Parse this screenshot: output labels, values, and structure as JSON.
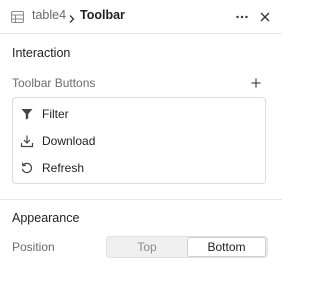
{
  "header": {
    "parent": "table4",
    "current": "Toolbar",
    "icons": {
      "table": "table-icon",
      "separator": "chevron-right-icon",
      "more": "more-horizontal-icon",
      "close": "close-icon"
    }
  },
  "interaction": {
    "title": "Interaction",
    "toolbar_buttons_label": "Toolbar Buttons",
    "add_icon": "plus-icon",
    "buttons": [
      {
        "label": "Filter",
        "icon": "filter-icon"
      },
      {
        "label": "Download",
        "icon": "download-icon"
      },
      {
        "label": "Refresh",
        "icon": "refresh-icon"
      }
    ]
  },
  "appearance": {
    "title": "Appearance",
    "position_label": "Position",
    "position_options": [
      "Top",
      "Bottom"
    ],
    "position_selected": "Bottom"
  }
}
